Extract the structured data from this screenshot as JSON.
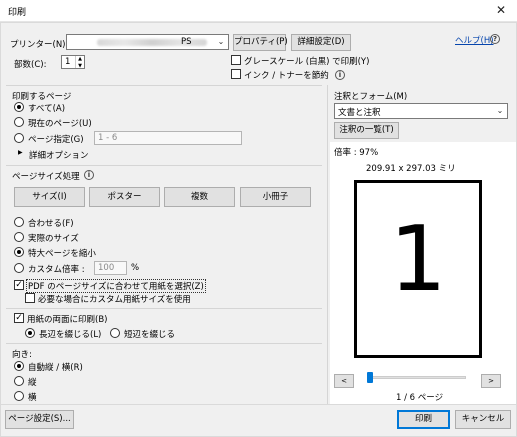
{
  "window": {
    "title": "印刷",
    "close": "✕"
  },
  "printer": {
    "label": "プリンター(N):",
    "value_suffix": "PS",
    "properties": "プロパティ(P)",
    "advanced": "詳細設定(D)",
    "help": "ヘルプ(H)"
  },
  "copies": {
    "label": "部数(C):",
    "value": "1"
  },
  "options": {
    "grayscale": "グレースケール (白黒) で印刷(Y)",
    "ink_saver": "インク / トナーを節約"
  },
  "pages_to_print": {
    "title": "印刷するページ",
    "all": "すべて(A)",
    "current": "現在のページ(U)",
    "specify": "ページ指定(G)",
    "range_placeholder": "1 - 6",
    "more": "詳細オプション"
  },
  "page_sizing": {
    "title": "ページサイズ処理",
    "tabs": [
      "サイズ(I)",
      "ポスター",
      "複数",
      "小冊子"
    ],
    "fit": "合わせる(F)",
    "actual": "実際のサイズ",
    "shrink": "特大ページを縮小",
    "custom_scale": "カスタム倍率 :",
    "custom_value": "100",
    "percent": "%",
    "choose_paper": "PDF のページサイズに合わせて用紙を選択(Z)",
    "custom_paper": "必要な場合にカスタム用紙サイズを使用"
  },
  "duplex": {
    "label": "用紙の両面に印刷(B)",
    "long": "長辺を綴じる(L)",
    "short": "短辺を綴じる"
  },
  "orientation": {
    "title": "向き:",
    "auto": "自動縦 / 横(R)",
    "portrait": "縦",
    "landscape": "横"
  },
  "comments": {
    "title": "注釈とフォーム(M)",
    "value": "文書と注釈",
    "summary": "注釈の一覧(T)"
  },
  "preview": {
    "zoom": "倍率 : 97%",
    "size": "209.91 x 297.03 ミリ",
    "page_number": "1",
    "prev": "<",
    "next": ">",
    "page_count": "1 / 6 ページ"
  },
  "footer": {
    "page_setup": "ページ設定(S)...",
    "print": "印刷",
    "cancel": "キャンセル"
  }
}
